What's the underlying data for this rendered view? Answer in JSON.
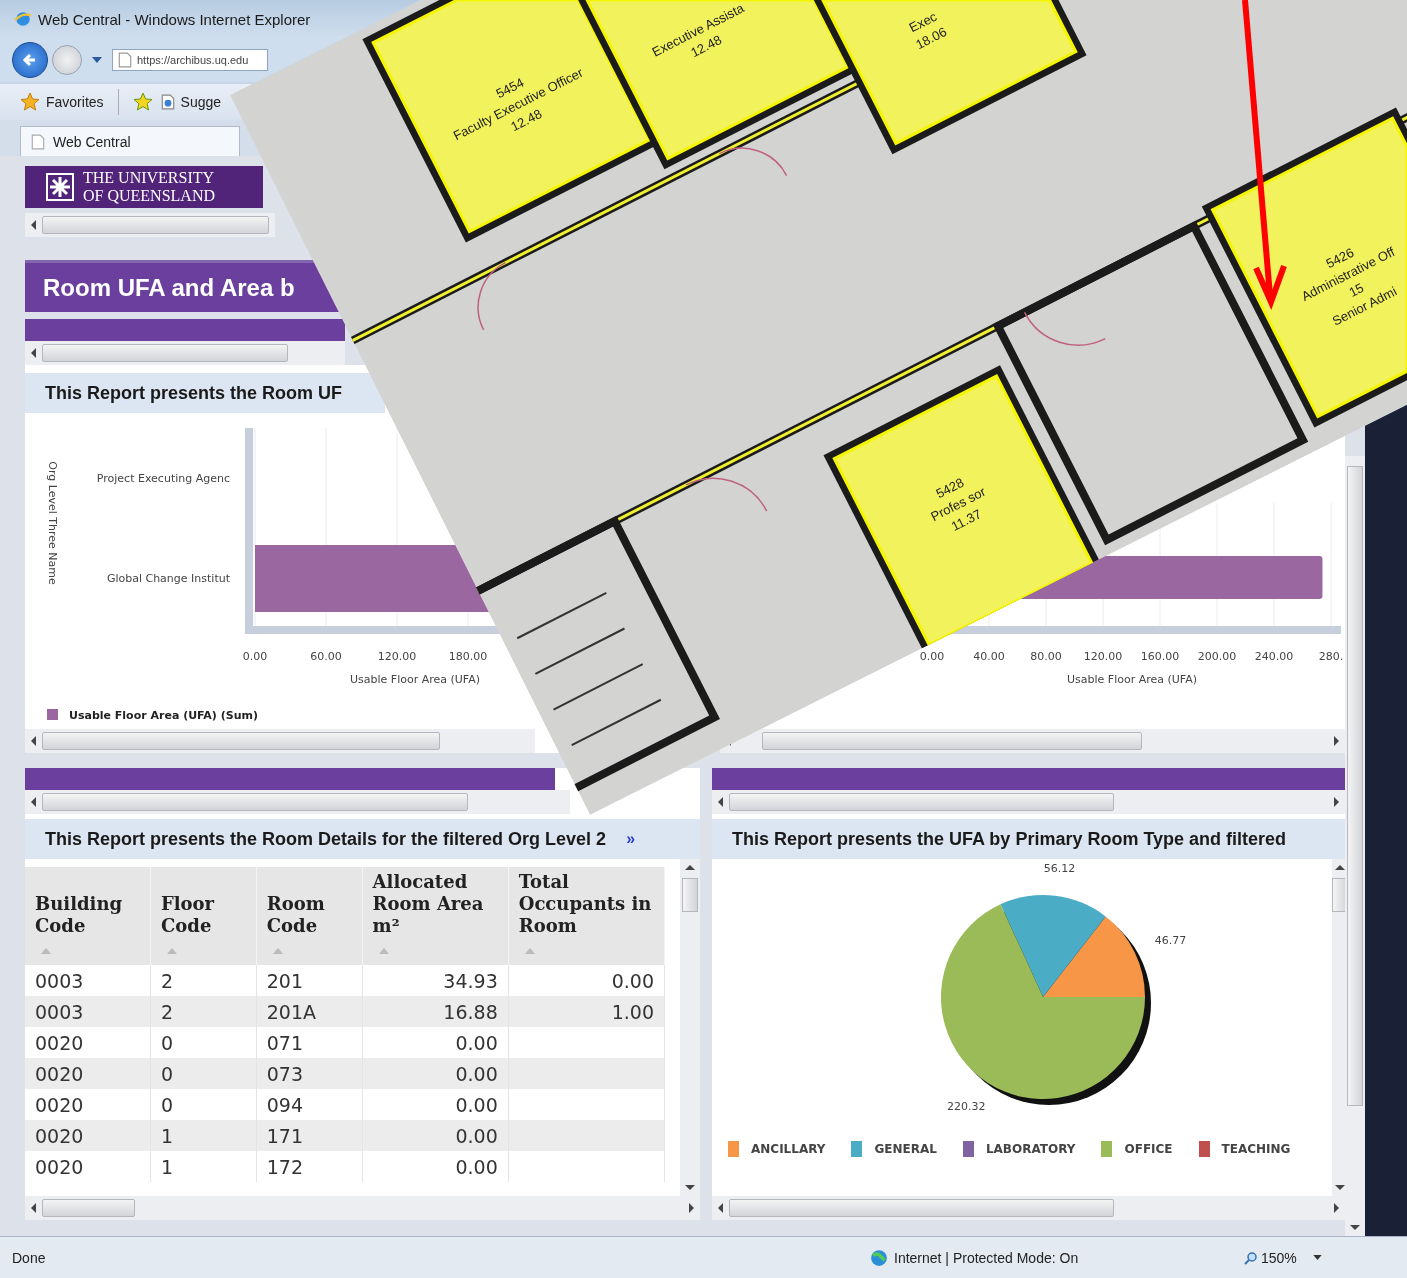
{
  "window": {
    "title": "Web Central - Windows Internet Explorer"
  },
  "address_bar": {
    "url": "https://archibus.uq.edu"
  },
  "favorites_bar": {
    "favorites": "Favorites",
    "suggested": "Sugge"
  },
  "tabs": [
    {
      "label": "Web Central",
      "selected": true
    }
  ],
  "banner": {
    "lines": [
      "THE UNIVERSITY",
      "OF QUEENSLAND"
    ]
  },
  "page_title": "Room UFA and Area b",
  "top_left_panel": {
    "title": "This Report presents the Room UF",
    "chart": {
      "y_axis_title": "Org Level Three Name",
      "x_axis_title": "Usable Floor Area (UFA)",
      "category_labels": [
        "Project Executing Agenc",
        "Global Change Institut"
      ],
      "tick_labels": [
        "0.00",
        "60.00",
        "120.00",
        "180.00"
      ],
      "legend": "Usable Floor Area (UFA) (Sum)"
    }
  },
  "top_right_panel": {
    "chart_data": {
      "type": "bar",
      "orientation": "horizontal",
      "grid": true,
      "xlabel": "Usable Floor Area (UFA)",
      "xlim": [
        0,
        280
      ],
      "xticks": [
        {
          "value": 0,
          "label": "0.00"
        },
        {
          "value": 40,
          "label": "40.00"
        },
        {
          "value": 80,
          "label": "80.00"
        },
        {
          "value": 120,
          "label": "120.00"
        },
        {
          "value": 160,
          "label": "160.00"
        },
        {
          "value": 200,
          "label": "200.00"
        },
        {
          "value": 240,
          "label": "240.00"
        },
        {
          "value": 280,
          "label": "280."
        }
      ],
      "series": [
        {
          "color": "#9b67a0",
          "values": [
            null,
            274
          ]
        }
      ]
    }
  },
  "room_details_panel": {
    "title": "This Report presents the Room Details for the filtered Org Level 2",
    "more": "»",
    "columns": [
      {
        "label": "Building Code",
        "kind": "text"
      },
      {
        "label": "Floor Code",
        "kind": "text"
      },
      {
        "label": "Room Code",
        "kind": "text"
      },
      {
        "label": "Allocated Room Area m²",
        "kind": "number"
      },
      {
        "label": "Total Occupants in Room",
        "kind": "number"
      }
    ],
    "rows": [
      {
        "cells": [
          "0003",
          "2",
          "201",
          "34.93",
          "0.00"
        ]
      },
      {
        "cells": [
          "0003",
          "2",
          "201A",
          "16.88",
          "1.00"
        ]
      },
      {
        "cells": [
          "0020",
          "0",
          "071",
          "0.00"
        ]
      },
      {
        "cells": [
          "0020",
          "0",
          "073",
          "0.00"
        ]
      },
      {
        "cells": [
          "0020",
          "0",
          "094",
          "0.00"
        ]
      },
      {
        "cells": [
          "0020",
          "1",
          "171",
          "0.00"
        ]
      },
      {
        "cells": [
          "0020",
          "1",
          "172",
          "0.00"
        ]
      }
    ]
  },
  "room_type_panel": {
    "title": "This Report presents the UFA by Primary Room Type and filtered",
    "chart_data": {
      "type": "pie",
      "categories": [
        "ANCILLARY",
        "GENERAL",
        "LABORATORY",
        "OFFICE",
        "TEACHING"
      ],
      "values": [
        46.77,
        56.12,
        null,
        220.32,
        null
      ],
      "data_labels": true
    },
    "legend": [
      {
        "color": "#f79646"
      },
      {
        "color": "#4bacc6"
      },
      {
        "color": "#8064a2"
      },
      {
        "color": "#9bbb59"
      },
      {
        "color": "#c0504d"
      }
    ]
  },
  "status_bar": {
    "status": "Done",
    "zone": "Internet | Protected Mode: On",
    "zoom": "150%"
  },
  "floor_plan": {
    "rooms": [
      {
        "lines": [
          "5454",
          "Faculty Executive Officer",
          "12.48"
        ]
      },
      {
        "lines": [
          "Executive Assista",
          "12.48"
        ]
      },
      {
        "lines": [
          "Exec",
          "18.06"
        ]
      },
      {
        "lines": [
          "5428",
          "Profes sor",
          "11.37"
        ]
      },
      {
        "lines": [
          "5426",
          "Administrative Off",
          "15",
          "Senior Admi"
        ]
      }
    ]
  }
}
